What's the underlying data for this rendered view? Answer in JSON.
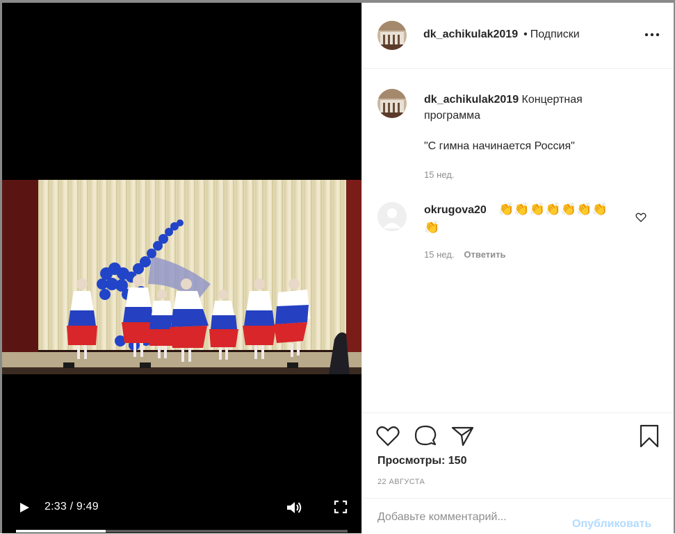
{
  "post": {
    "username": "dk_achikulak2019",
    "separator": "•",
    "follow_label": "Подписки",
    "caption_text": "Концертная программа",
    "caption_quote": "\"С гимна начинается Россия\"",
    "caption_age": "15 нед."
  },
  "video": {
    "current_time": "2:33",
    "separator": " / ",
    "duration": "9:49",
    "progress": 0.27
  },
  "comments": [
    {
      "username": "okrugova20",
      "text": "👏👏👏👏👏👏👏",
      "text_line2": "👏",
      "age": "15 нед.",
      "reply_label": "Ответить"
    }
  ],
  "stats": {
    "views_label": "Просмотры: 150",
    "date": "22 августа"
  },
  "comment_box": {
    "placeholder": "Добавьте комментарий...",
    "post_label": "Опубликовать"
  },
  "icons": {
    "play": "play-icon",
    "volume": "volume-icon",
    "fullscreen": "fullscreen-icon",
    "more": "more-icon",
    "like": "heart-icon",
    "comment": "comment-icon",
    "share": "share-icon",
    "save": "bookmark-icon"
  },
  "colors": {
    "accent_disabled": "#b3dbff",
    "text_primary": "#262626",
    "text_secondary": "#8e8e8e",
    "divider": "#efefef"
  }
}
